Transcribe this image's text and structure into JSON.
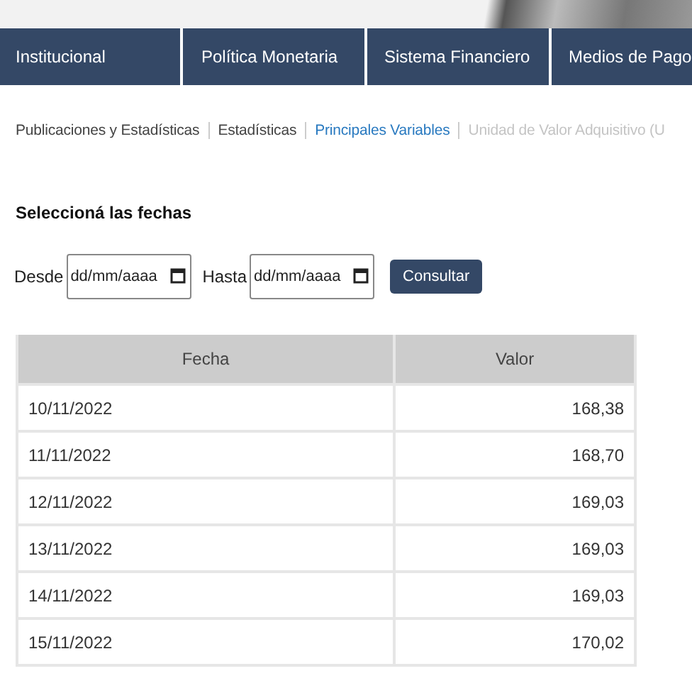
{
  "nav": {
    "items": [
      {
        "label": "Institucional"
      },
      {
        "label": "Política Monetaria"
      },
      {
        "label": "Sistema Financiero"
      },
      {
        "label": "Medios de Pago"
      }
    ]
  },
  "breadcrumb": [
    {
      "label": "Publicaciones y Estadísticas",
      "kind": "plain"
    },
    {
      "label": "Estadísticas",
      "kind": "plain"
    },
    {
      "label": "Principales Variables",
      "kind": "link"
    },
    {
      "label": "Unidad de Valor Adquisitivo (U",
      "kind": "current"
    }
  ],
  "form": {
    "title": "Seleccioná las fechas",
    "from_label": "Desde",
    "from_placeholder": "dd/mm/aaaa",
    "to_label": "Hasta",
    "to_placeholder": "dd/mm/aaaa",
    "button": "Consultar"
  },
  "table": {
    "columns": [
      "Fecha",
      "Valor"
    ],
    "rows": [
      [
        "10/11/2022",
        "168,38"
      ],
      [
        "11/11/2022",
        "168,70"
      ],
      [
        "12/11/2022",
        "169,03"
      ],
      [
        "13/11/2022",
        "169,03"
      ],
      [
        "14/11/2022",
        "169,03"
      ],
      [
        "15/11/2022",
        "170,02"
      ]
    ]
  }
}
